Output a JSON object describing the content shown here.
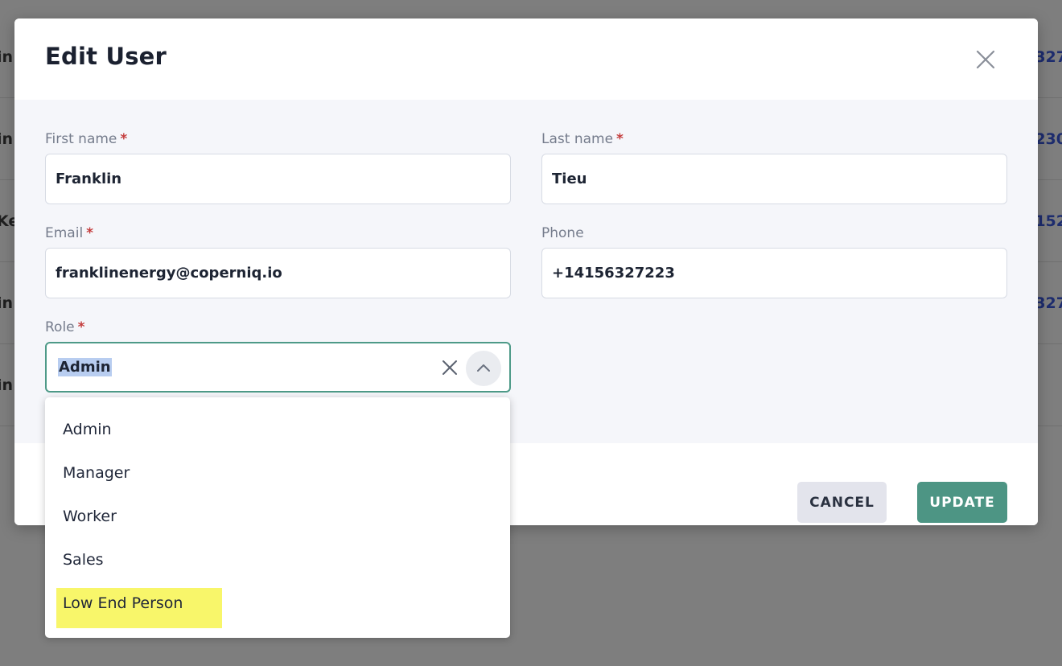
{
  "background": {
    "rows": [
      {
        "left": "in",
        "right": "327"
      },
      {
        "left": "in",
        "right": "230"
      },
      {
        "left": "Ke",
        "right": "152"
      },
      {
        "left": "in",
        "right": "327"
      },
      {
        "left": "in",
        "right": ""
      }
    ]
  },
  "modal": {
    "title": "Edit User",
    "fields": {
      "first_name": {
        "label": "First name",
        "required": "*",
        "value": "Franklin"
      },
      "last_name": {
        "label": "Last name",
        "required": "*",
        "value": "Tieu"
      },
      "email": {
        "label": "Email",
        "required": "*",
        "value": "franklinenergy@coperniq.io"
      },
      "phone": {
        "label": "Phone",
        "value": "+14156327223"
      },
      "role": {
        "label": "Role",
        "required": "*",
        "value": "Admin"
      }
    },
    "buttons": {
      "cancel": "CANCEL",
      "update": "UPDATE"
    }
  },
  "role_options": [
    "Admin",
    "Manager",
    "Worker",
    "Sales",
    "Low End Person"
  ],
  "colors": {
    "accent": "#4d9584",
    "highlight": "#f8f66a",
    "required": "#c43d3d"
  }
}
